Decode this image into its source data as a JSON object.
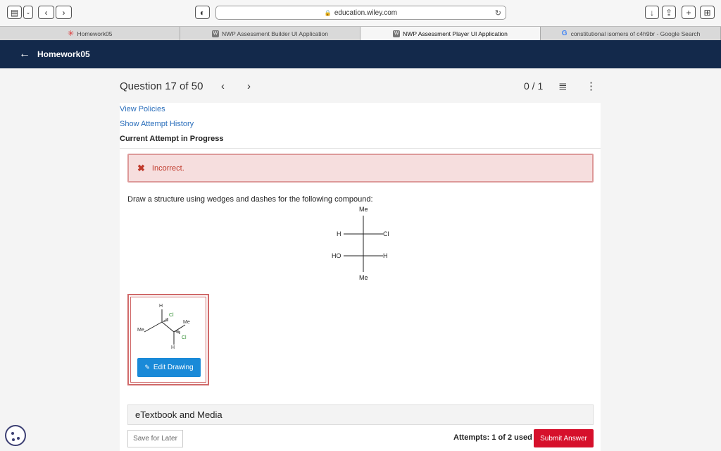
{
  "browser": {
    "url": "education.wiley.com",
    "tabs": [
      {
        "label": "Homework05",
        "active": false
      },
      {
        "label": "NWP Assessment Builder UI Application",
        "active": false
      },
      {
        "label": "NWP Assessment Player UI Application",
        "active": true
      },
      {
        "label": "constitutional isomers of c4h9br - Google Search",
        "active": false
      }
    ]
  },
  "app": {
    "title": "Homework05"
  },
  "question": {
    "title": "Question 17 of 50",
    "score": "0 / 1",
    "links": {
      "policies": "View Policies",
      "history": "Show Attempt History"
    },
    "attempt_status": "Current Attempt in Progress",
    "feedback": "Incorrect.",
    "prompt": "Draw a structure using wedges and dashes for the following compound:",
    "fischer": {
      "top": "Me",
      "bottom": "Me",
      "row1_left": "H",
      "row1_right": "Cl",
      "row2_left": "HO",
      "row2_right": "H"
    },
    "answer_drawing": {
      "labels": [
        "H",
        "Cl",
        "Me",
        "Me",
        "Cl",
        "H"
      ]
    },
    "edit_drawing": "Edit Drawing",
    "etextbook": "eTextbook and Media",
    "save_later": "Save for Later",
    "attempts": "Attempts: 1 of 2 used",
    "submit": "Submit Answer"
  },
  "colors": {
    "header_bg": "#13294b",
    "error": "#c0392b",
    "submit": "#d6102b",
    "edit_button": "#1a8ad8"
  }
}
